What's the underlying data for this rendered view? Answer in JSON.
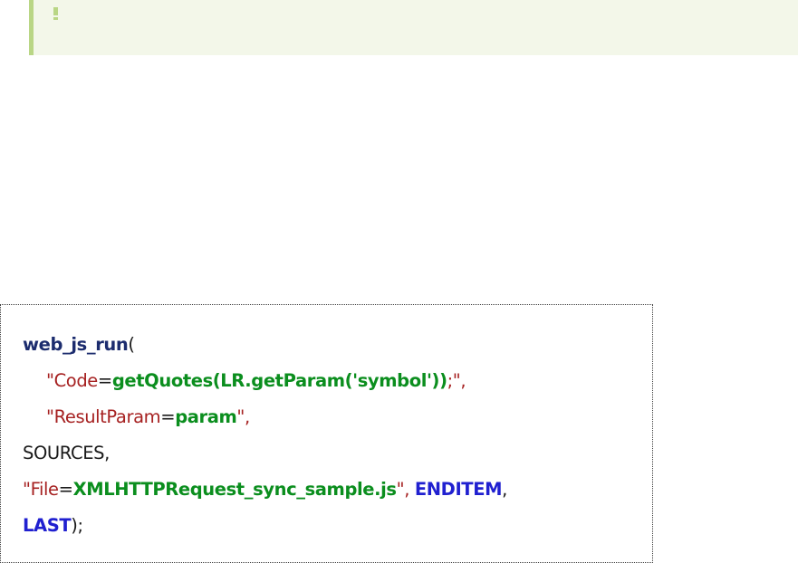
{
  "note": {
    "icon": "exclamation-icon",
    "accent_color": "#b9d685",
    "background_color": "#f3f7e9"
  },
  "code": {
    "line1": {
      "func": "web_js_run",
      "paren": "("
    },
    "line2": {
      "q_open": "\"",
      "key": "Code",
      "eq": "=",
      "value": "getQuotes(LR.getParam('symbol'))",
      "tail": ";\","
    },
    "line3": {
      "q_open": "\"",
      "key": "ResultParam",
      "eq": "=",
      "value": "param",
      "tail": "\","
    },
    "line4": {
      "text": "SOURCES,"
    },
    "line5": {
      "q_open": "\"",
      "key": "File",
      "eq": "=",
      "value": "XMLHTTPRequest_sync_sample.js",
      "q_close": "\",",
      "sep": " ",
      "enditem": "ENDITEM",
      "tail": ","
    },
    "line6": {
      "last": "LAST",
      "tail": ");"
    },
    "colors": {
      "function": "#1c2c6e",
      "keyword": "#2020d0",
      "string": "#a62121",
      "value": "#0b8e1e"
    }
  }
}
